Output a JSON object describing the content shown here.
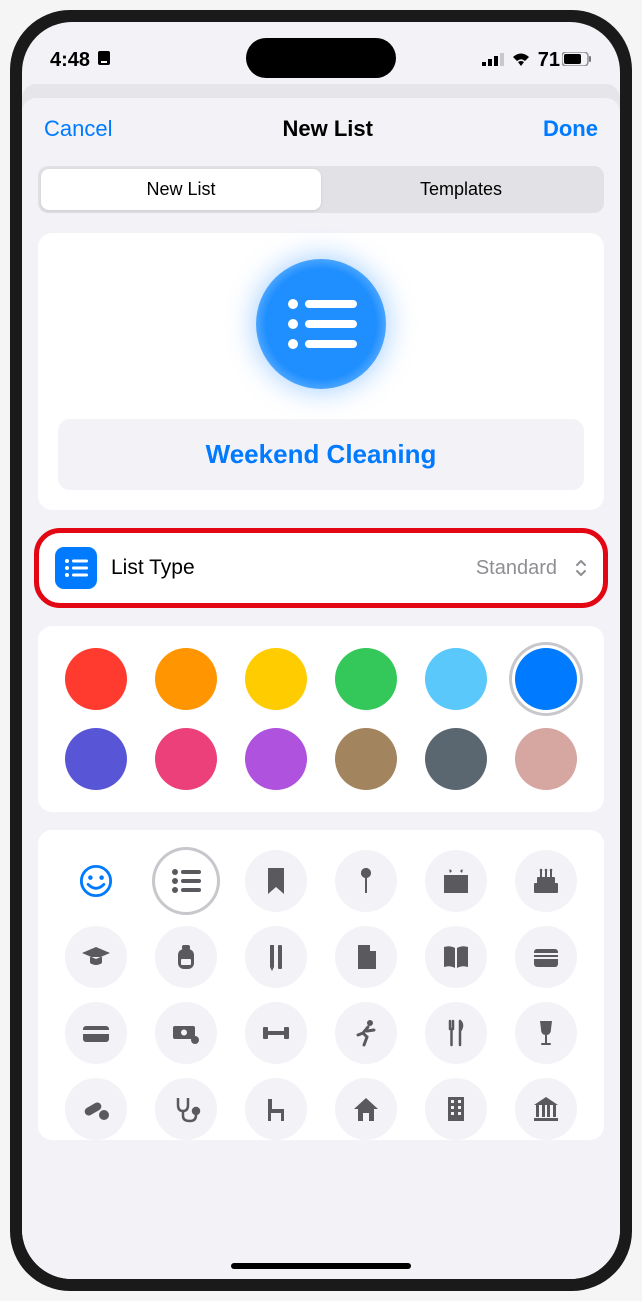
{
  "status": {
    "time": "4:48",
    "battery_pct": "71"
  },
  "nav": {
    "cancel": "Cancel",
    "title": "New List",
    "done": "Done"
  },
  "segmented": {
    "new_list": "New List",
    "templates": "Templates"
  },
  "list": {
    "name": "Weekend Cleaning",
    "type_label": "List Type",
    "type_value": "Standard"
  },
  "colors": [
    {
      "hex": "#ff3b30",
      "selected": false
    },
    {
      "hex": "#ff9500",
      "selected": false
    },
    {
      "hex": "#ffcc00",
      "selected": false
    },
    {
      "hex": "#34c759",
      "selected": false
    },
    {
      "hex": "#5ac8fa",
      "selected": false
    },
    {
      "hex": "#007aff",
      "selected": true
    },
    {
      "hex": "#5856d6",
      "selected": false
    },
    {
      "hex": "#ec407a",
      "selected": false
    },
    {
      "hex": "#af52de",
      "selected": false
    },
    {
      "hex": "#a2845e",
      "selected": false
    },
    {
      "hex": "#5b6770",
      "selected": false
    },
    {
      "hex": "#d6a6a1",
      "selected": false
    }
  ],
  "icons": [
    {
      "name": "emoji-icon",
      "glyph": "emoji",
      "style": "emoji"
    },
    {
      "name": "list-bullet-icon",
      "glyph": "list",
      "selected": true
    },
    {
      "name": "bookmark-icon",
      "glyph": "bookmark"
    },
    {
      "name": "pin-icon",
      "glyph": "pin"
    },
    {
      "name": "gift-icon",
      "glyph": "gift"
    },
    {
      "name": "birthday-cake-icon",
      "glyph": "cake"
    },
    {
      "name": "graduation-cap-icon",
      "glyph": "grad"
    },
    {
      "name": "backpack-icon",
      "glyph": "backpack"
    },
    {
      "name": "pencil-ruler-icon",
      "glyph": "pencil"
    },
    {
      "name": "document-icon",
      "glyph": "doc"
    },
    {
      "name": "book-icon",
      "glyph": "book"
    },
    {
      "name": "wallet-icon",
      "glyph": "wallet"
    },
    {
      "name": "credit-card-icon",
      "glyph": "card"
    },
    {
      "name": "money-icon",
      "glyph": "money"
    },
    {
      "name": "dumbbell-icon",
      "glyph": "dumbbell"
    },
    {
      "name": "running-icon",
      "glyph": "run"
    },
    {
      "name": "fork-knife-icon",
      "glyph": "fork"
    },
    {
      "name": "wine-glass-icon",
      "glyph": "wine"
    },
    {
      "name": "pills-icon",
      "glyph": "pills"
    },
    {
      "name": "stethoscope-icon",
      "glyph": "steth"
    },
    {
      "name": "furniture-icon",
      "glyph": "chair"
    },
    {
      "name": "house-icon",
      "glyph": "house"
    },
    {
      "name": "building-icon",
      "glyph": "building"
    },
    {
      "name": "bank-icon",
      "glyph": "bank"
    }
  ]
}
